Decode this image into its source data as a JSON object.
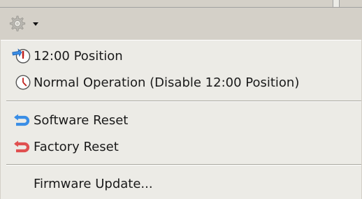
{
  "toolbar": {
    "settings_icon": "gear-icon",
    "dropdown_icon": "caret-down-icon"
  },
  "menu": {
    "items": [
      {
        "label": "12:00 Position",
        "icon": "clock-set-icon"
      },
      {
        "label": "Normal Operation (Disable 12:00 Position)",
        "icon": "clock-icon"
      },
      {
        "label": "Software Reset",
        "icon": "software-reset-icon"
      },
      {
        "label": "Factory Reset",
        "icon": "factory-reset-icon"
      },
      {
        "label": "Firmware Update...",
        "icon": ""
      }
    ]
  },
  "colors": {
    "menu_background": "#ecebe6",
    "frame_background": "#d4d0c8",
    "software_reset_blue": "#3a8ee6",
    "factory_reset_red": "#e05050",
    "clock_red": "#c0201c"
  }
}
